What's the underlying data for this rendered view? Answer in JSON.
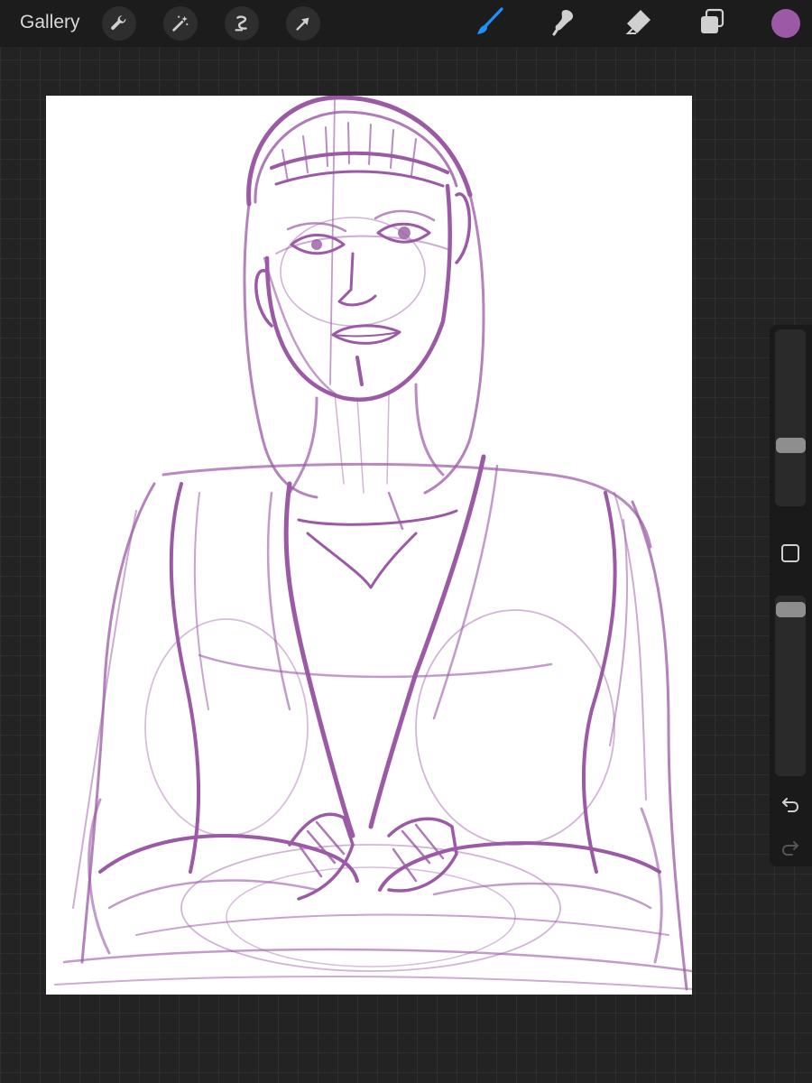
{
  "toolbar": {
    "gallery_label": "Gallery",
    "left_tools": [
      "wrench-icon",
      "magic-wand-icon",
      "selection-icon",
      "transform-arrow-icon"
    ],
    "right_tools": [
      "brush-icon",
      "smudge-icon",
      "eraser-icon",
      "layers-icon"
    ],
    "active_tool": "brush",
    "active_tool_color": "#1e90ff",
    "current_color": "#9b59a6"
  },
  "sidebar": {
    "brush_size": 0.33,
    "brush_opacity": 0.96,
    "controls": [
      "modify-button",
      "undo-icon",
      "redo-icon"
    ]
  },
  "canvas": {
    "background": "#ffffff",
    "stroke_color": "#9b59a6",
    "content": "sketch"
  }
}
